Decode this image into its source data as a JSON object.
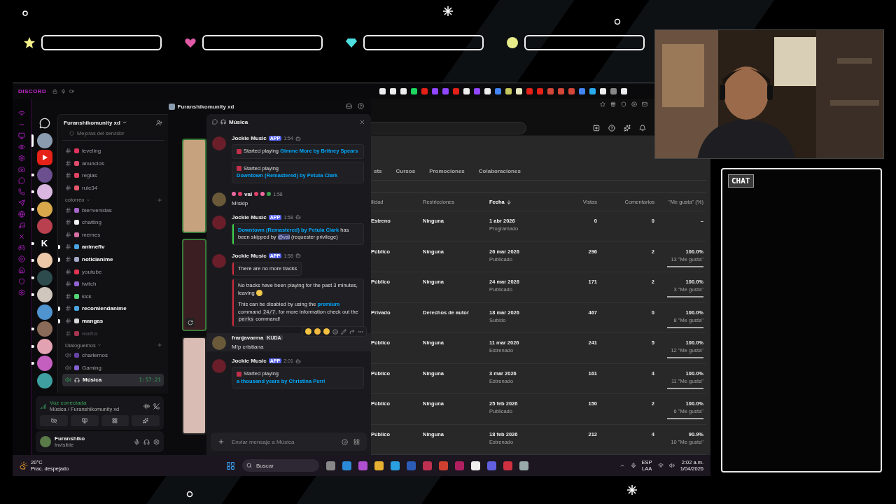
{
  "hud_bars": [
    {
      "kind": "star",
      "level": 0
    },
    {
      "kind": "heart",
      "level": 0
    },
    {
      "kind": "gem",
      "level": 0
    },
    {
      "kind": "coin",
      "level": 0
    }
  ],
  "chat_overlay": {
    "title": "CHAT"
  },
  "discord": {
    "app_label": "DISCORD",
    "window_title": "Furanshikomunity xd",
    "servers": [
      {
        "kind": "avatar",
        "color": "#8a9bb0",
        "selected": true,
        "unread": false
      },
      {
        "kind": "youtube",
        "color": "#e62117",
        "selected": false,
        "unread": false
      },
      {
        "kind": "avatar",
        "color": "#6b4f8f",
        "selected": false,
        "unread": true
      },
      {
        "kind": "avatar",
        "color": "#d9b7e0",
        "selected": false,
        "unread": true
      },
      {
        "kind": "avatar",
        "color": "#d8a84a",
        "selected": false,
        "unread": true
      },
      {
        "kind": "avatar",
        "color": "#b9404e",
        "selected": false,
        "unread": false
      },
      {
        "kind": "letter",
        "label": "K",
        "color": "#0b0b0d",
        "selected": false,
        "unread": true
      },
      {
        "kind": "avatar",
        "color": "#ecc8a8",
        "selected": false,
        "unread": true
      },
      {
        "kind": "avatar",
        "color": "#2d4b4d",
        "selected": false,
        "unread": true
      },
      {
        "kind": "avatar",
        "color": "#cfc7be",
        "selected": false,
        "unread": true
      },
      {
        "kind": "avatar",
        "color": "#4f93cf",
        "selected": false,
        "unread": false
      },
      {
        "kind": "avatar",
        "color": "#8a6a58",
        "selected": false,
        "unread": true
      },
      {
        "kind": "avatar",
        "color": "#e3a2b2",
        "selected": false,
        "unread": true
      },
      {
        "kind": "avatar",
        "color": "#c45fc0",
        "selected": false,
        "unread": true
      },
      {
        "kind": "avatar",
        "color": "#3f9ea0",
        "selected": false,
        "unread": false
      }
    ],
    "server_name": "Furanshikomunity xd",
    "boost_label": "Mejoras del servidor",
    "channel_groups": [
      {
        "channels": [
          {
            "name": "leveling",
            "kind": "text",
            "color": "#e0345f",
            "unread": false,
            "muted": false,
            "selected": false
          },
          {
            "name": "anuncios",
            "kind": "text",
            "color": "#e04a6e",
            "unread": false,
            "muted": false,
            "selected": false
          },
          {
            "name": "reglas",
            "kind": "text",
            "color": "#e24262",
            "unread": false,
            "muted": false,
            "selected": false
          },
          {
            "name": "rule34",
            "kind": "text",
            "color": "#e8586c",
            "unread": false,
            "muted": false,
            "selected": false
          }
        ]
      },
      {
        "category": "cotorreo",
        "channels": [
          {
            "name": "bienvenidas",
            "kind": "text",
            "color": "#a466c8",
            "unread": false,
            "muted": false,
            "selected": false
          },
          {
            "name": "chatting",
            "kind": "text",
            "color": "#f2f2f2",
            "unread": false,
            "muted": false,
            "selected": false
          },
          {
            "name": "memes",
            "kind": "text",
            "color": "#d46ea4",
            "unread": false,
            "muted": false,
            "selected": false
          },
          {
            "name": "animeflv",
            "kind": "text",
            "color": "#4aa3e2",
            "unread": true,
            "muted": false,
            "selected": false
          },
          {
            "name": "noticianime",
            "kind": "text",
            "color": "#a3a8c8",
            "unread": true,
            "muted": false,
            "selected": false
          },
          {
            "name": "youtube",
            "kind": "text",
            "color": "#e23452",
            "unread": false,
            "muted": false,
            "selected": false
          },
          {
            "name": "twitch",
            "kind": "text",
            "color": "#9064d4",
            "unread": false,
            "muted": false,
            "selected": false
          },
          {
            "name": "kick",
            "kind": "text",
            "color": "#53d474",
            "unread": false,
            "muted": false,
            "selected": false
          },
          {
            "name": "recomiendanime",
            "kind": "text",
            "color": "#4aa3e2",
            "unread": true,
            "muted": false,
            "selected": false
          },
          {
            "name": "mangas",
            "kind": "text",
            "color": "#d8d8d8",
            "unread": true,
            "muted": false,
            "selected": false
          },
          {
            "name": "waifus",
            "kind": "text",
            "color": "#a83450",
            "unread": false,
            "muted": true,
            "selected": false
          }
        ]
      },
      {
        "category": "Dialoguemos",
        "channels": [
          {
            "name": "charlemos",
            "kind": "voice",
            "color": "#6544a6",
            "unread": false,
            "muted": false,
            "selected": false
          },
          {
            "name": "Gaming",
            "kind": "voice",
            "color": "#8462d4",
            "unread": false,
            "muted": false,
            "selected": false
          },
          {
            "name": "Música",
            "kind": "voice",
            "unread": false,
            "muted": false,
            "selected": true,
            "timer": "1:57:21"
          }
        ]
      }
    ],
    "voice": {
      "status": "Voz conectada",
      "location": "Música / Furanshikomunity xd"
    },
    "user": {
      "name": "Furanshiko",
      "status": "Invisible"
    }
  },
  "popup": {
    "title": "Música",
    "messages": [
      {
        "kind": "bot",
        "author": "Jockie Music",
        "badge": "APP",
        "time": "1:54",
        "embeds": [
          {
            "icon": true,
            "paragraphs": [
              [
                {
                  "t": "Started playing "
                },
                {
                  "t": "Gimme More by Britney Spears",
                  "kind": "link"
                }
              ]
            ]
          },
          {
            "icon": true,
            "paragraphs": [
              [
                {
                  "t": "Started playing "
                },
                {
                  "t": "Downtown (Remastered) by Petula Clark",
                  "kind": "link"
                }
              ]
            ]
          }
        ]
      },
      {
        "kind": "user",
        "author": "val",
        "decorated": true,
        "time": "1:58",
        "text": "M!skip",
        "hovered": false
      },
      {
        "kind": "bot",
        "author": "Jockie Music",
        "badge": "APP",
        "time": "1:58",
        "embeds": [
          {
            "color": "#3ed44a",
            "icon": false,
            "paragraphs": [
              [
                {
                  "t": "Downtown (Remastered) by Petula Clark",
                  "kind": "link"
                },
                {
                  "t": " has been skipped by "
                },
                {
                  "t": "@val",
                  "kind": "mention"
                },
                {
                  "t": " (requester privilege)"
                }
              ]
            ]
          }
        ]
      },
      {
        "kind": "bot",
        "author": "Jockie Music",
        "badge": "APP",
        "time": "1:58",
        "embeds": [
          {
            "color": "#d0283a",
            "icon": false,
            "paragraphs": [
              [
                {
                  "t": "There are no more tracks"
                }
              ]
            ]
          },
          {
            "color": "#d0283a",
            "icon": false,
            "paragraphs": [
              [
                {
                  "t": "No tracks have been playing for the past 3 minutes, leaving "
                },
                {
                  "kind": "wave"
                }
              ],
              [
                {
                  "t": "This can be disabled by using the "
                },
                {
                  "t": "premium",
                  "kind": "link"
                },
                {
                  "t": " command "
                },
                {
                  "t": "24/7",
                  "kind": "code"
                },
                {
                  "t": ", for more information check out the "
                },
                {
                  "t": "perks",
                  "kind": "code"
                },
                {
                  "t": " command!"
                }
              ]
            ]
          }
        ]
      },
      {
        "kind": "user",
        "author": "franjavarma",
        "tag": "KUDA",
        "text": "M!p cristiana",
        "hovered": true,
        "decorated": false
      },
      {
        "kind": "bot",
        "author": "Jockie Music",
        "badge": "APP",
        "time": "2:01",
        "embeds": [
          {
            "icon": true,
            "paragraphs": [
              [
                {
                  "t": "Started playing "
                },
                {
                  "t": "a thousand years by Christina Perri",
                  "kind": "link"
                }
              ]
            ]
          }
        ]
      }
    ],
    "input": {
      "placeholder": "Enviar mensaje a Música"
    }
  },
  "studio": {
    "tabs": [
      {
        "label": "sts",
        "selected": false
      },
      {
        "label": "Cursos",
        "selected": false
      },
      {
        "label": "Promociones",
        "selected": false
      },
      {
        "label": "Colaboraciones",
        "selected": false
      }
    ],
    "columns": [
      {
        "label": "ilidad",
        "sorted": false
      },
      {
        "label": "Restricciones",
        "sorted": false
      },
      {
        "label": "Fecha",
        "sorted": true
      },
      {
        "label": "Vistas",
        "sorted": false
      },
      {
        "label": "Comentarios",
        "sorted": false
      },
      {
        "label": "\"Me gusta\" (%)",
        "sorted": false
      }
    ],
    "rows": [
      {
        "visibility": "Estreno",
        "restriction": "Ninguna",
        "date": "1 abr 2026",
        "status": "Programado",
        "views": "0",
        "comments": "0",
        "likes": "–"
      },
      {
        "visibility": "Público",
        "restriction": "Ninguna",
        "date": "26 mar 2026",
        "status": "Publicado",
        "views": "296",
        "comments": "2",
        "likes": "100.0%",
        "likes_count": "13 \"Me gusta\"",
        "level": 1
      },
      {
        "visibility": "Público",
        "restriction": "Ninguna",
        "date": "24 mar 2026",
        "status": "Publicado",
        "views": "171",
        "comments": "2",
        "likes": "100.0%",
        "likes_count": "3 \"Me gusta\"",
        "level": 1
      },
      {
        "visibility": "Privado",
        "restriction": "Derechos de autor",
        "date": "18 mar 2026",
        "status": "Subido",
        "views": "467",
        "comments": "0",
        "likes": "100.0%",
        "likes_count": "8 \"Me gusta\"",
        "level": 1
      },
      {
        "visibility": "Público",
        "restriction": "Ninguna",
        "date": "11 mar 2026",
        "status": "Estrenado",
        "views": "241",
        "comments": "5",
        "likes": "100.0%",
        "likes_count": "12 \"Me gusta\"",
        "level": 1
      },
      {
        "visibility": "Público",
        "restriction": "Ninguna",
        "date": "3 mar 2026",
        "status": "Estrenado",
        "views": "161",
        "comments": "4",
        "likes": "100.0%",
        "likes_count": "11 \"Me gusta\"",
        "level": 1
      },
      {
        "visibility": "Público",
        "restriction": "Ninguna",
        "date": "25 feb 2026",
        "status": "Publicado",
        "views": "150",
        "comments": "2",
        "likes": "100.0%",
        "likes_count": "6 \"Me gusta\"",
        "level": 1
      },
      {
        "visibility": "Público",
        "restriction": "Ninguna",
        "date": "18 feb 2026",
        "status": "Estrenado",
        "views": "212",
        "comments": "4",
        "likes": "90.9%",
        "likes_count": "10 \"Me gusta\""
      }
    ]
  },
  "taskbar": {
    "weather_temp": "20°C",
    "weather_text": "Prac. despejado",
    "search_placeholder": "Buscar",
    "lang": "ESP",
    "layout": "LAA",
    "time": "2:02 a.m.",
    "date": "1/04/2026"
  }
}
